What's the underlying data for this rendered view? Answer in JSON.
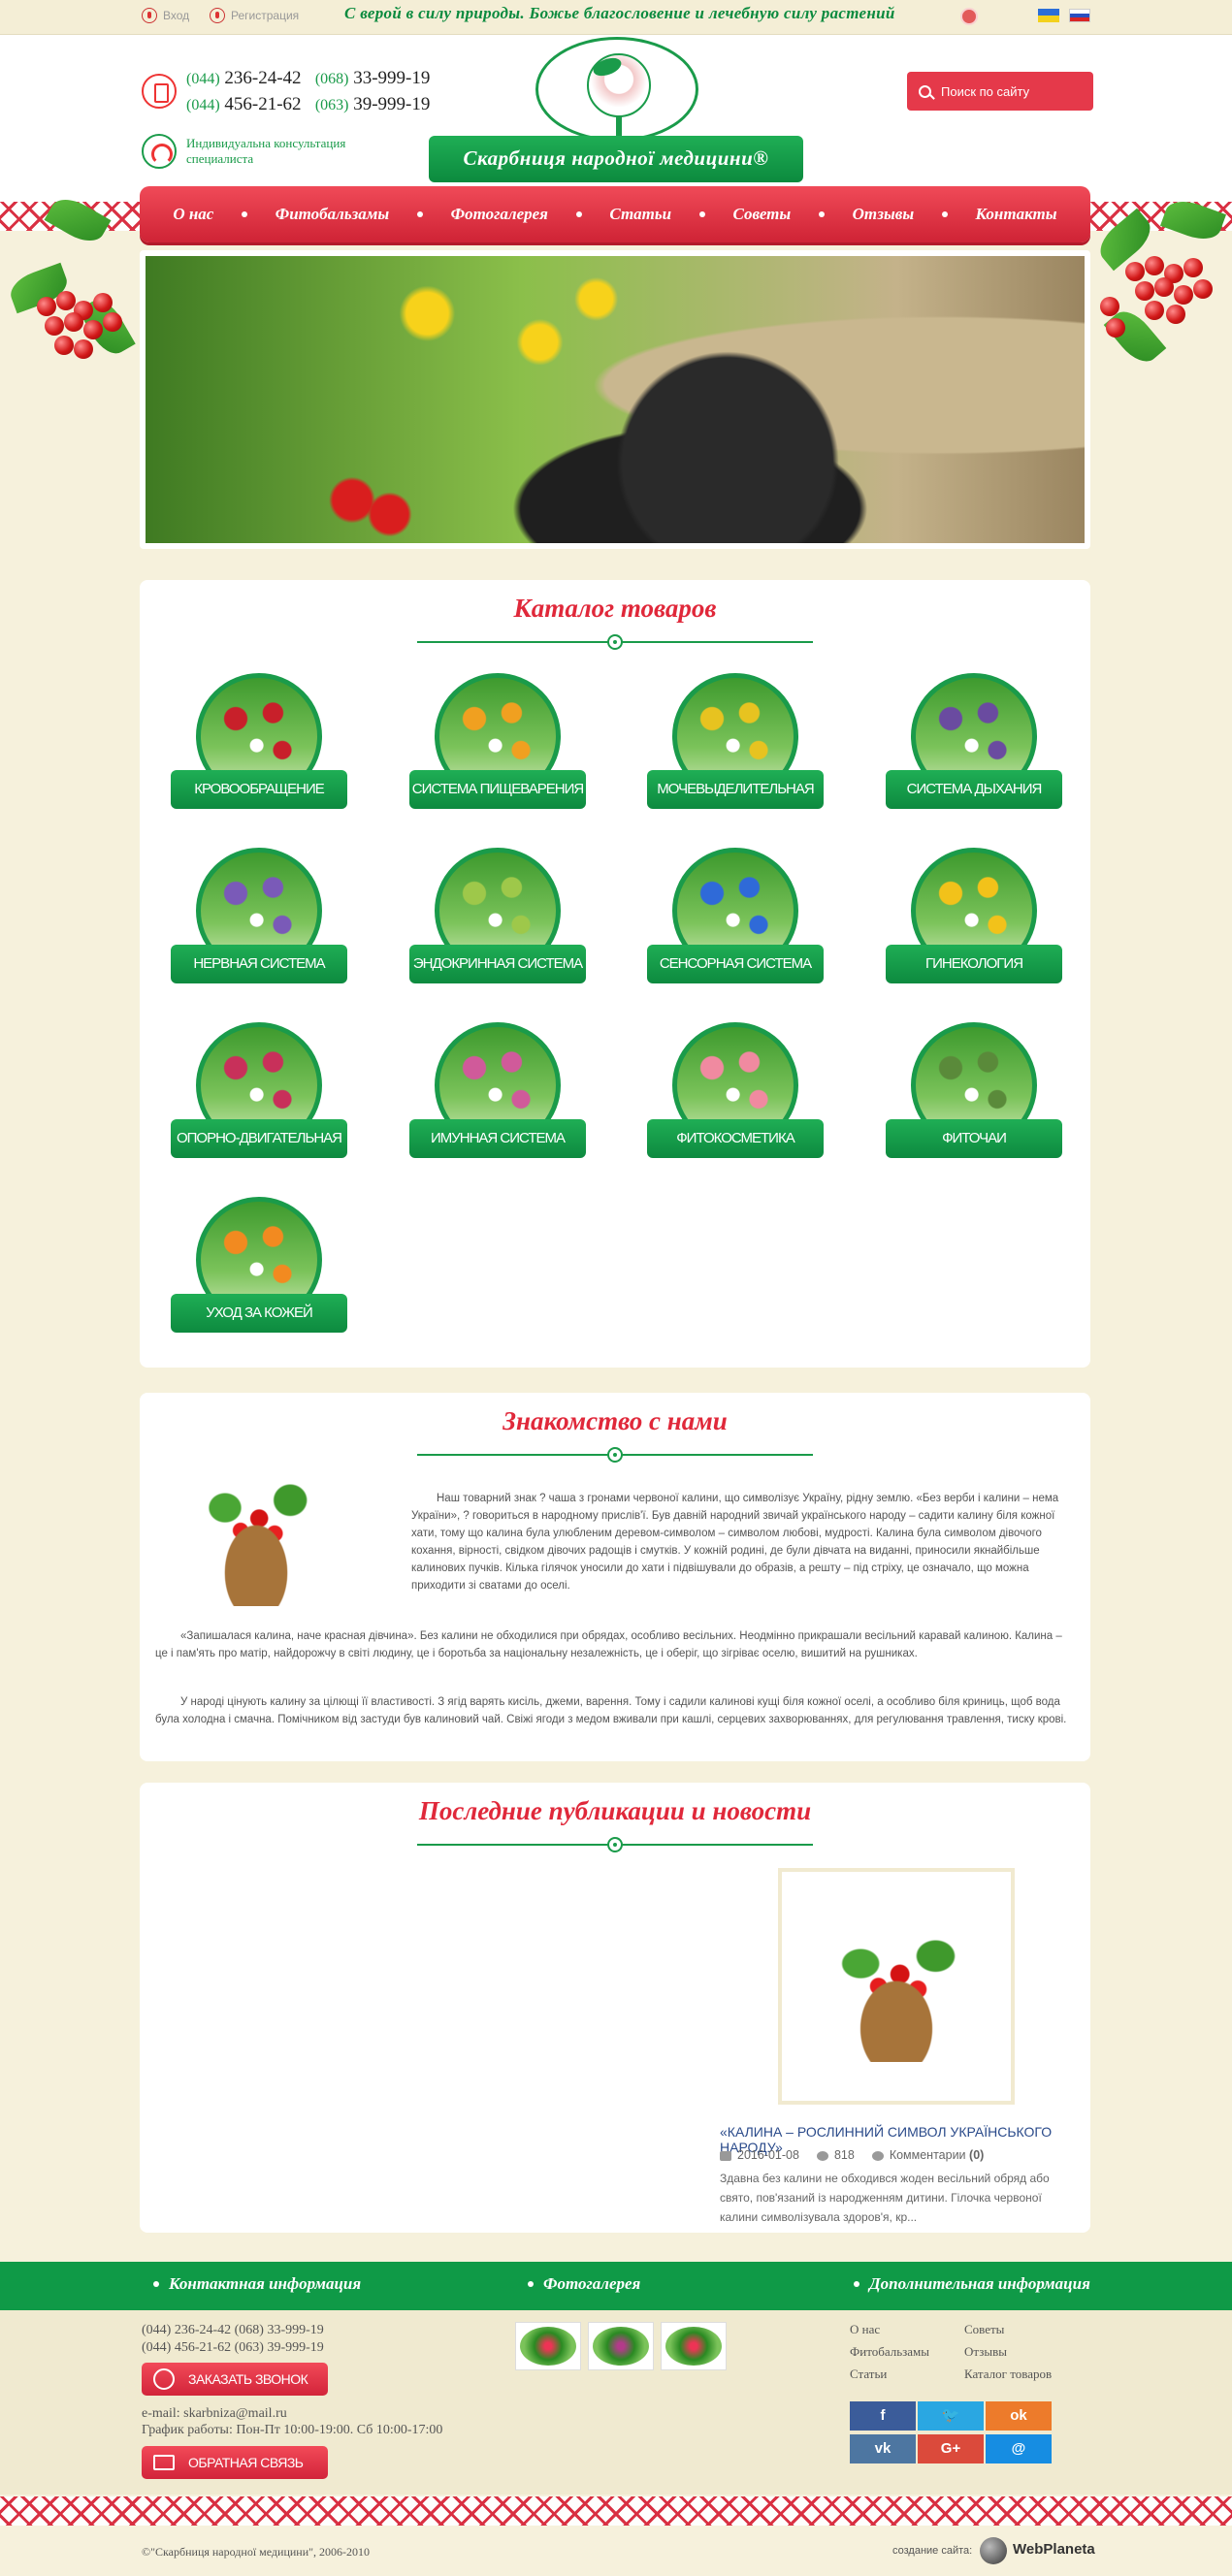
{
  "topbar": {
    "login": "Вход",
    "register": "Регистрация",
    "slogan": "С верой в силу природы. Божье благословение и лечебную силу растений"
  },
  "header": {
    "phones": [
      {
        "code": "(044)",
        "num": "236-24-42",
        "code2": "(068)",
        "num2": "33-999-19"
      },
      {
        "code": "(044)",
        "num": "456-21-62",
        "code2": "(063)",
        "num2": "39-999-19"
      }
    ],
    "consult": "Индивидуальна консультация специалиста",
    "logo_title": "Скарбниця народної медицини®",
    "search_placeholder": "Поиск по сайту"
  },
  "nav": [
    "О нас",
    "Фитобальзамы",
    "Фотогалерея",
    "Статьи",
    "Советы",
    "Отзывы",
    "Контакты"
  ],
  "catalog": {
    "title": "Каталог товаров",
    "items": [
      "КРОВООБРАЩЕНИЕ",
      "СИСТЕМА ПИЩЕВАРЕНИЯ",
      "МОЧЕВЫДЕЛИТЕЛЬНАЯ",
      "СИСТЕМА ДЫХАНИЯ",
      "НЕРВНАЯ СИСТЕМА",
      "ЭНДОКРИННАЯ СИСТЕМА",
      "СЕНСОРНАЯ СИСТЕМА",
      "ГИНЕКОЛОГИЯ",
      "ОПОРНО-ДВИГАТЕЛЬНАЯ",
      "ИМУННАЯ СИСТЕМА",
      "ФИТОКОСМЕТИКА",
      "ФИТОЧАИ",
      "УХОД ЗА КОЖЕЙ"
    ],
    "colors": [
      "#c8202a",
      "#f0a020",
      "#e7c320",
      "#6a4ba0",
      "#7a5ab8",
      "#9ec84a",
      "#2f6ad8",
      "#f2c21a",
      "#c8305a",
      "#d05a9a",
      "#f08aa0",
      "#5a8a3a",
      "#f28a20"
    ]
  },
  "about": {
    "title": "Знакомство с нами",
    "p1": "Наш товарний знак ? чаша з гронами червоної калини, що символізує Україну,  рідну землю. «Без верби і калини – нема України», ? говориться в народному прислів'ї. Був давній народний звичай українського народу – садити калину біля кожної хати, тому що калина була улюбленим деревом-символом – символом любові, мудрості.      Калина була символом дівочого кохання, вірності, свідком дівочих радощів і смутків. У кожній родині, де були дівчата на виданні, приносили якнайбільше калинових пучків. Кілька гілячок уносили до хати і підвішували до образів, а решту – під стріху, це означало, що можна приходити зі сватами до оселі.",
    "p2": "«Запишалася калина, наче красная дівчина». Без калини не обходилися при обрядах, особливо весільних. Неодмінно прикрашали весільний каравай калиною. Калина – це і пам'ять про матір, найдорожчу в світі людину, це і боротьба за національну незалежність, це і оберіг, що зігріває оселю, вишитий на рушниках.",
    "p3": "У народі цінують калину за цілющі її властивості. З ягід варять кисіль, джеми, варення. Тому і садили калинові кущі біля кожної оселі, а особливо біля криниць, щоб вода була холодна і смачна. Помічником від застуди був калиновий чай. Свіжі ягоди з медом вживали при кашлі, серцевих захворюваннях, для регулювання травлення, тиску крові."
  },
  "news": {
    "title": "Последние публикации и новости",
    "item_title": "«КАЛИНА – РОСЛИННИЙ СИМВОЛ УКРАЇНСЬКОГО НАРОДУ»",
    "date": "2016-01-08",
    "views": "818",
    "comments_label": "Комментарии",
    "comments_count": "(0)",
    "text": "Здавна без калини не обходився жоден весільний обряд або свято, пов'язаний із народженням дитини. Гілочка червоної калини символізувала здоров'я, кр..."
  },
  "footer": {
    "contact_title": "Контактная информация",
    "gallery_title": "Фотогалерея",
    "extra_title": "Дополнительная информация",
    "phone_line1": "(044) 236-24-42   (068) 33-999-19",
    "phone_line2": "(044) 456-21-62   (063) 39-999-19",
    "order_call": "ЗАКАЗАТЬ ЗВОНОК",
    "email": "e-mail: skarbniza@mail.ru",
    "hours": "График работы: Пон-Пт 10:00-19:00. Сб 10:00-17:00",
    "feedback": "ОБРАТНАЯ СВЯЗЬ",
    "links": [
      "О нас",
      "Советы",
      "Фитобальзамы",
      "Отзывы",
      "Статьи",
      "Каталог товаров"
    ],
    "social": [
      {
        "icon": "facebook-icon",
        "glyph": "f",
        "color": "#3b5c9a"
      },
      {
        "icon": "twitter-icon",
        "glyph": "🐦",
        "color": "#2aa7e2"
      },
      {
        "icon": "odnoklassniki-icon",
        "glyph": "ok",
        "color": "#ed7b2b"
      },
      {
        "icon": "vk-icon",
        "glyph": "vk",
        "color": "#4d76a1"
      },
      {
        "icon": "google-plus-icon",
        "glyph": "G+",
        "color": "#db4a3b"
      },
      {
        "icon": "moi-mir-icon",
        "glyph": "@",
        "color": "#168de2"
      }
    ],
    "copyright": "©\"Скарбниця народної медицини\", 2006-2010",
    "made_by": "создание сайта:",
    "dev_name": "WebPlaneta"
  }
}
